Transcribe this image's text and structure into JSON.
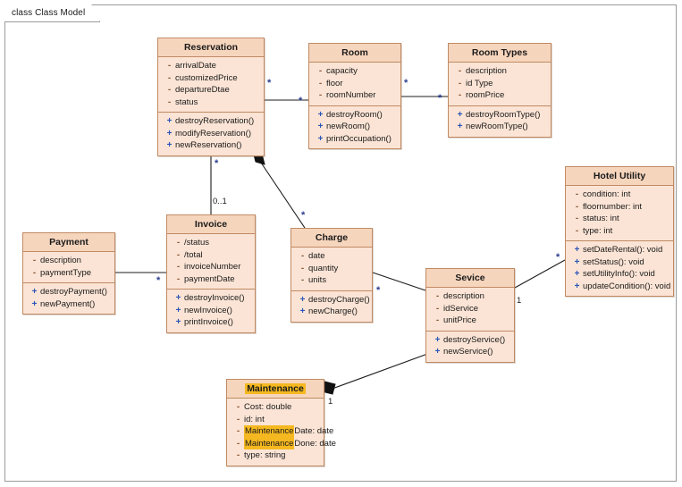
{
  "frame": {
    "label": "class Class Model"
  },
  "classes": [
    {
      "id": "reservation",
      "name": "Reservation",
      "attributes": [
        {
          "vis": "-",
          "text": "arrivalDate"
        },
        {
          "vis": "-",
          "text": "customizedPrice"
        },
        {
          "vis": "-",
          "text": "departureDtae"
        },
        {
          "vis": "-",
          "text": "status"
        }
      ],
      "operations": [
        {
          "vis": "+",
          "text": "destroyReservation()"
        },
        {
          "vis": "+",
          "text": "modifyReservation()"
        },
        {
          "vis": "+",
          "text": "newReservation()"
        }
      ]
    },
    {
      "id": "room",
      "name": "Room",
      "attributes": [
        {
          "vis": "-",
          "text": "capacity"
        },
        {
          "vis": "-",
          "text": "floor"
        },
        {
          "vis": "-",
          "text": "roomNumber"
        }
      ],
      "operations": [
        {
          "vis": "+",
          "text": "destroyRoom()"
        },
        {
          "vis": "+",
          "text": "newRoom()"
        },
        {
          "vis": "+",
          "text": "printOccupation()"
        }
      ]
    },
    {
      "id": "roomtypes",
      "name": "Room Types",
      "attributes": [
        {
          "vis": "-",
          "text": "description"
        },
        {
          "vis": "-",
          "text": "id Type"
        },
        {
          "vis": "-",
          "text": "roomPrice"
        }
      ],
      "operations": [
        {
          "vis": "+",
          "text": "destroyRoomType()"
        },
        {
          "vis": "+",
          "text": "newRoomType()"
        }
      ]
    },
    {
      "id": "hotelutil",
      "name": "Hotel Utility",
      "attributes": [
        {
          "vis": "-",
          "text": "condition: int"
        },
        {
          "vis": "-",
          "text": "floornumber: int"
        },
        {
          "vis": "-",
          "text": "status: int"
        },
        {
          "vis": "-",
          "text": "type: int"
        }
      ],
      "operations": [
        {
          "vis": "+",
          "text": "setDateRental(): void"
        },
        {
          "vis": "+",
          "text": "setStatus(): void"
        },
        {
          "vis": "+",
          "text": "setUtilityInfo(): void"
        },
        {
          "vis": "+",
          "text": "updateCondition(): void"
        }
      ]
    },
    {
      "id": "invoice",
      "name": "Invoice",
      "attributes": [
        {
          "vis": "-",
          "text": "/status"
        },
        {
          "vis": "-",
          "text": "/total"
        },
        {
          "vis": "-",
          "text": "invoiceNumber"
        },
        {
          "vis": "-",
          "text": "paymentDate"
        }
      ],
      "operations": [
        {
          "vis": "+",
          "text": "destroyInvoice()"
        },
        {
          "vis": "+",
          "text": "newInvoice()"
        },
        {
          "vis": "+",
          "text": "printInvoice()"
        }
      ]
    },
    {
      "id": "payment",
      "name": "Payment",
      "attributes": [
        {
          "vis": "-",
          "text": "description"
        },
        {
          "vis": "-",
          "text": "paymentType"
        }
      ],
      "operations": [
        {
          "vis": "+",
          "text": "destroyPayment()"
        },
        {
          "vis": "+",
          "text": "newPayment()"
        }
      ]
    },
    {
      "id": "charge",
      "name": "Charge",
      "attributes": [
        {
          "vis": "-",
          "text": "date"
        },
        {
          "vis": "-",
          "text": "quantity"
        },
        {
          "vis": "-",
          "text": "units"
        }
      ],
      "operations": [
        {
          "vis": "+",
          "text": "destroyCharge()"
        },
        {
          "vis": "+",
          "text": "newCharge()"
        }
      ]
    },
    {
      "id": "sevice",
      "name": "Sevice",
      "attributes": [
        {
          "vis": "-",
          "text": "description"
        },
        {
          "vis": "-",
          "text": "idService"
        },
        {
          "vis": "-",
          "text": "unitPrice"
        }
      ],
      "operations": [
        {
          "vis": "+",
          "text": "destroyService()"
        },
        {
          "vis": "+",
          "text": "newService()"
        }
      ]
    },
    {
      "id": "maintenance",
      "name": "Maintenance",
      "name_highlighted": true,
      "attributes": [
        {
          "vis": "-",
          "text": "Cost: double"
        },
        {
          "vis": "-",
          "text": "id: int"
        },
        {
          "vis": "-",
          "highlight": "Maintenance",
          "text": "Date: date"
        },
        {
          "vis": "-",
          "highlight": "Maintenance",
          "text": "Done: date"
        },
        {
          "vis": "-",
          "text": "type: string"
        }
      ],
      "operations": []
    }
  ],
  "associations": [
    {
      "id": "reservation-room",
      "from": "Reservation",
      "to": "Room",
      "from_mult": "*",
      "to_mult": "*",
      "type": "association"
    },
    {
      "id": "room-roomtypes",
      "from": "Room",
      "to": "Room Types",
      "from_mult": "*",
      "to_mult": "*",
      "type": "association"
    },
    {
      "id": "reservation-invoice",
      "from": "Reservation",
      "to": "Invoice",
      "from_mult": "*",
      "to_mult": "0..1",
      "type": "association"
    },
    {
      "id": "reservation-charge",
      "from": "Reservation",
      "to": "Charge",
      "from_mult": "",
      "to_mult": "*",
      "type": "composition"
    },
    {
      "id": "payment-invoice",
      "from": "Payment",
      "to": "Invoice",
      "from_mult": "",
      "to_mult": "*",
      "type": "association"
    },
    {
      "id": "charge-sevice",
      "from": "Charge",
      "to": "Sevice",
      "from_mult": "*",
      "to_mult": "",
      "type": "association"
    },
    {
      "id": "sevice-hotelutility",
      "from": "Sevice",
      "to": "Hotel Utility",
      "from_mult": "1",
      "to_mult": "*",
      "type": "association"
    },
    {
      "id": "maintenance-sevice",
      "from": "Maintenance",
      "to": "Sevice",
      "from_mult": "1",
      "to_mult": "1",
      "type": "composition"
    }
  ],
  "multiplicity_labels": {
    "res_room_left": "*",
    "res_room_right": "*",
    "room_rt_left": "*",
    "room_rt_right": "*",
    "res_inv_top": "*",
    "res_inv_bottom": "0..1",
    "res_charge": "*",
    "pay_inv": "*",
    "charge_sev": "*",
    "sev_hu_left": "1",
    "sev_hu_right": "*",
    "maint_sev_top": "1",
    "maint_sev_bottom": "1"
  },
  "colors": {
    "class_body": "#fbe4d5",
    "class_header": "#f6d5bd",
    "class_border": "#c08a63",
    "highlight": "#f5b820",
    "private_marker": "#8a5a3b",
    "public_marker": "#2a55b8",
    "connector": "#1c1c1c",
    "frame_border": "#9a9a9a"
  }
}
